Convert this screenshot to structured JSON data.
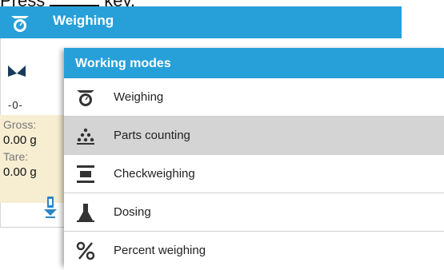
{
  "top_text": {
    "before": "Press",
    "after": "key."
  },
  "header": {
    "title": "Weighing",
    "icon": "scale-icon"
  },
  "background": {
    "zero_indicator": "-0-",
    "gross_label": "Gross:",
    "gross_value": "0.00 g",
    "tare_label": "Tare:",
    "tare_value": "0.00 g"
  },
  "popup": {
    "title": "Working modes",
    "items": [
      {
        "label": "Weighing",
        "icon": "scale-icon"
      },
      {
        "label": "Parts counting",
        "icon": "parts-counting-icon"
      },
      {
        "label": "Checkweighing",
        "icon": "checkweighing-icon"
      },
      {
        "label": "Dosing",
        "icon": "dosing-icon"
      },
      {
        "label": "Percent weighing",
        "icon": "percent-icon"
      }
    ],
    "selected_index": 1
  },
  "colors": {
    "accent": "#27a0d9",
    "selected_row": "#d4d4d4",
    "info_box": "#f7eed2"
  }
}
